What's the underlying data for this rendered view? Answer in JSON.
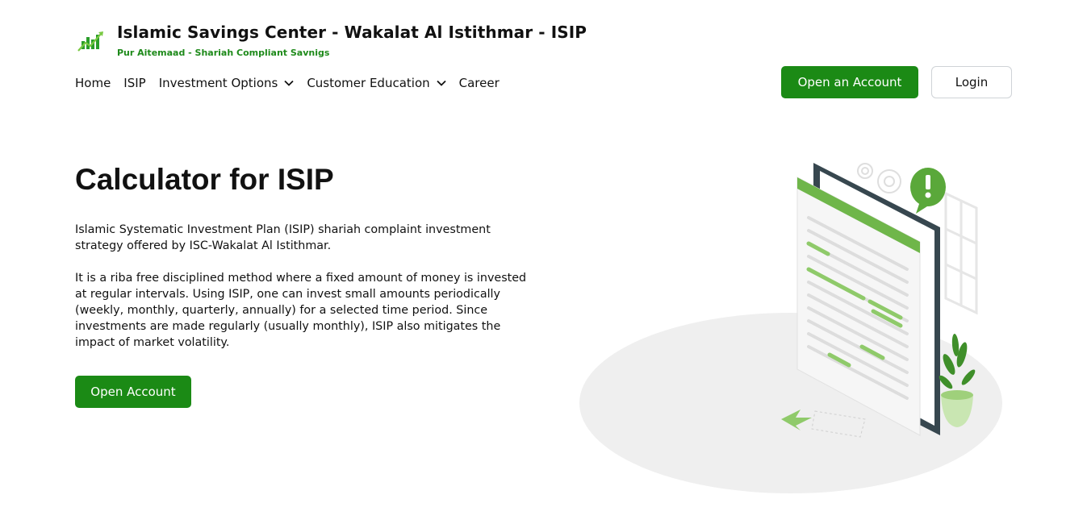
{
  "brand": {
    "title": "Islamic Savings Center - Wakalat Al Istithmar - ISIP",
    "tagline": "Pur Aitemaad - Shariah Compliant Savnigs",
    "logo_icon": "growth-chart-icon"
  },
  "nav": {
    "items": [
      {
        "label": "Home"
      },
      {
        "label": "ISIP"
      },
      {
        "label": "Investment Options",
        "icon": "chevron-down-icon"
      },
      {
        "label": "Customer Education",
        "icon": "chevron-down-icon"
      },
      {
        "label": "Career"
      }
    ],
    "open_account_label": "Open an Account",
    "login_label": "Login"
  },
  "hero": {
    "title": "Calculator for ISIP",
    "paragraph1": "Islamic Systematic Investment Plan (ISIP) shariah complaint investment strategy offered by ISC-Wakalat Al Istithmar.",
    "paragraph2": "It is a riba free disciplined method where a fixed amount of money is invested at regular intervals. Using ISIP, one can invest small amounts periodically (weekly, monthly, quarterly, annually) for a selected time period. Since investments are made regularly (usually monthly), ISIP also mitigates the impact of market volatility.",
    "button_label": "Open Account"
  },
  "colors": {
    "brand_green": "#1b8a15",
    "tagline_green": "#1e8a1a",
    "illustration_green": "#6fb64a"
  }
}
